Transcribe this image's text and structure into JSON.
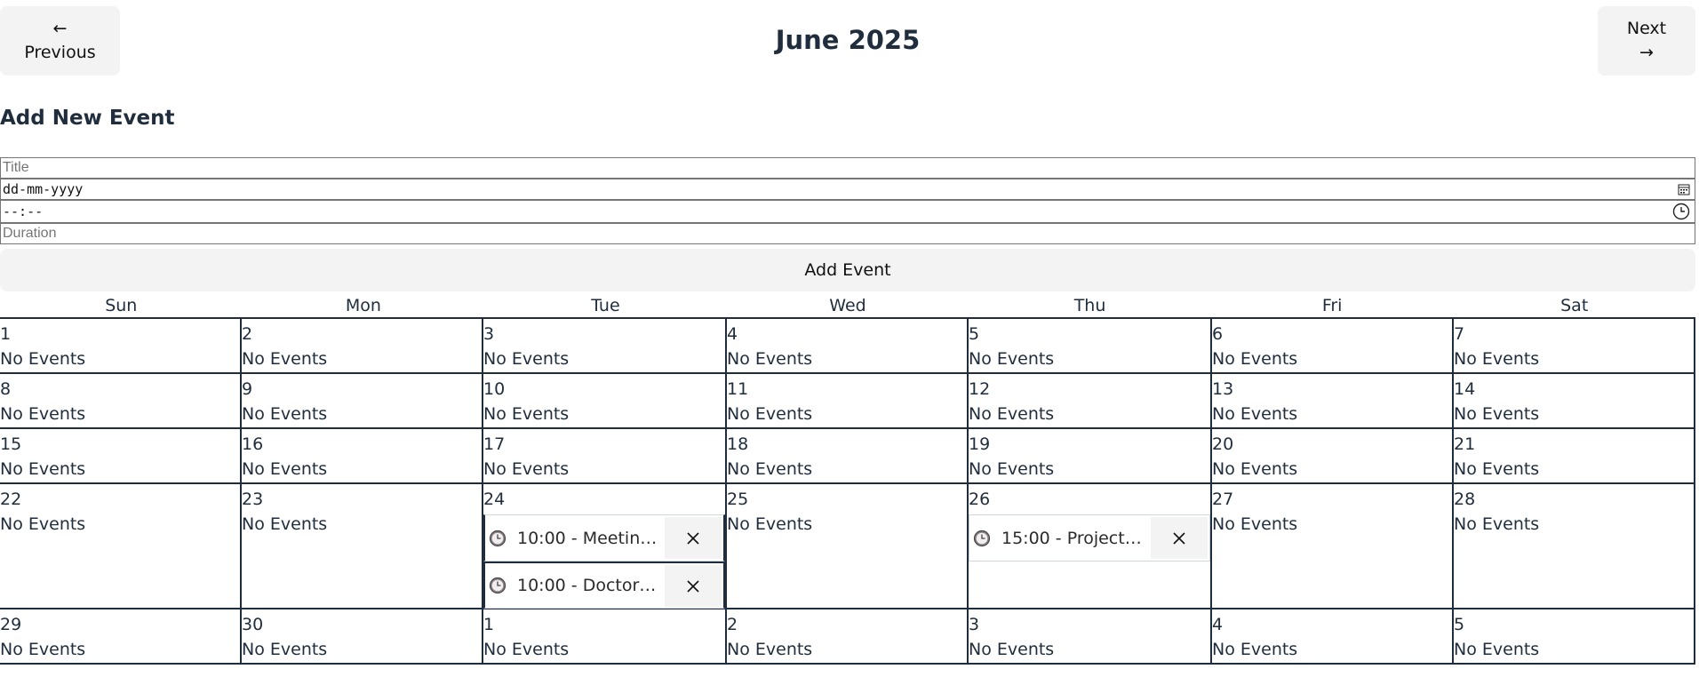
{
  "header": {
    "prev_arrow": "←",
    "prev_label": "Previous",
    "next_label": "Next",
    "next_arrow": "→",
    "month_title": "June 2025"
  },
  "form": {
    "heading": "Add New Event",
    "title_placeholder": "Title",
    "date_value": "dd-mm-yyyy",
    "time_value": "--:--",
    "duration_placeholder": "Duration",
    "submit_label": "Add Event"
  },
  "weekdays": [
    "Sun",
    "Mon",
    "Tue",
    "Wed",
    "Thu",
    "Fri",
    "Sat"
  ],
  "no_events_label": "No Events",
  "weeks": [
    [
      {
        "day": "1"
      },
      {
        "day": "2"
      },
      {
        "day": "3"
      },
      {
        "day": "4"
      },
      {
        "day": "5"
      },
      {
        "day": "6"
      },
      {
        "day": "7"
      }
    ],
    [
      {
        "day": "8"
      },
      {
        "day": "9"
      },
      {
        "day": "10"
      },
      {
        "day": "11"
      },
      {
        "day": "12"
      },
      {
        "day": "13"
      },
      {
        "day": "14"
      }
    ],
    [
      {
        "day": "15"
      },
      {
        "day": "16"
      },
      {
        "day": "17"
      },
      {
        "day": "18"
      },
      {
        "day": "19"
      },
      {
        "day": "20"
      },
      {
        "day": "21"
      }
    ],
    [
      {
        "day": "22"
      },
      {
        "day": "23"
      },
      {
        "day": "24",
        "events": [
          "10:00 - Meeting ...",
          "10:00 - Doctor A..."
        ]
      },
      {
        "day": "25"
      },
      {
        "day": "26",
        "events": [
          "15:00 - Project D..."
        ]
      },
      {
        "day": "27"
      },
      {
        "day": "28"
      }
    ],
    [
      {
        "day": "29"
      },
      {
        "day": "30"
      },
      {
        "day": "1"
      },
      {
        "day": "2"
      },
      {
        "day": "3"
      },
      {
        "day": "4"
      },
      {
        "day": "5"
      }
    ]
  ],
  "colors": {
    "text": "#1f2d3d",
    "button_bg": "#f3f3f3",
    "grid_line": "#1f2d3d",
    "clock_fill": "#8a7f86"
  },
  "icons": {
    "event_icon": "clock-icon",
    "delete_icon": "close-icon",
    "date_picker": "calendar-icon",
    "time_picker": "clock-icon"
  }
}
